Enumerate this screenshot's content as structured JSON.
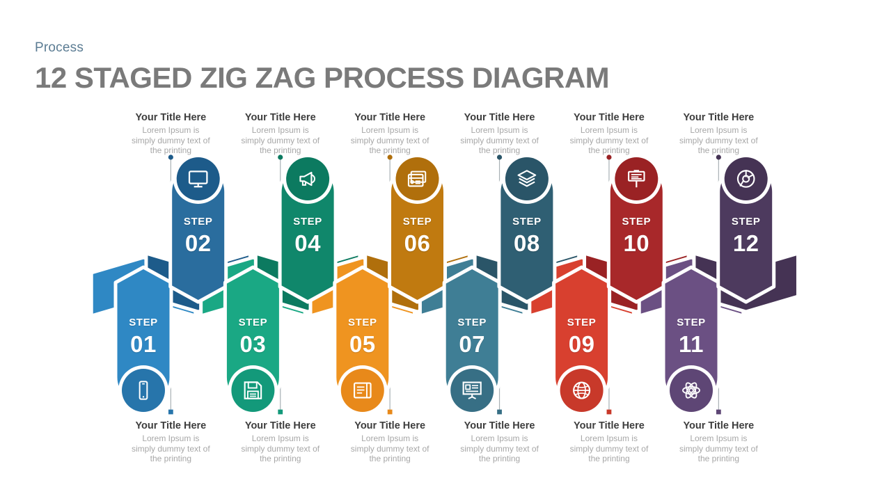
{
  "header": {
    "kicker": "Process",
    "title": "12 STAGED ZIG ZAG PROCESS DIAGRAM"
  },
  "defaults": {
    "label_title": "Your Title Here",
    "label_desc_line1": "Lorem Ipsum is",
    "label_desc_line2": "simply dummy text of",
    "label_desc_line3": "the printing",
    "step_word": "STEP"
  },
  "palette": {
    "title_gray": "#7a7a7a",
    "kicker_blue": "#5b7c93",
    "desc_gray": "#a7a7a7",
    "label_dark": "#3d3d3d",
    "connector_gray": "#9aa3a8",
    "white": "#ffffff"
  },
  "steps": [
    {
      "number": "01",
      "step_word": "STEP",
      "row": "bottom",
      "icon": "mobile-icon",
      "color_light": "#2f88c4",
      "color_dark": "#2775ab",
      "title": "Your Title Here",
      "desc": [
        "Lorem Ipsum is",
        "simply dummy text of",
        "the printing"
      ]
    },
    {
      "number": "02",
      "step_word": "STEP",
      "row": "top",
      "icon": "monitor-icon",
      "color_light": "#2a6d9e",
      "color_dark": "#1d5b8a",
      "title": "Your Title Here",
      "desc": [
        "Lorem Ipsum is",
        "simply dummy text of",
        "the printing"
      ]
    },
    {
      "number": "03",
      "step_word": "STEP",
      "row": "bottom",
      "icon": "floppy-disk-icon",
      "color_light": "#1aa884",
      "color_dark": "#13997a",
      "title": "Your Title Here",
      "desc": [
        "Lorem Ipsum is",
        "simply dummy text of",
        "the printing"
      ]
    },
    {
      "number": "04",
      "step_word": "STEP",
      "row": "top",
      "icon": "megaphone-icon",
      "color_light": "#10876b",
      "color_dark": "#0c7a60",
      "title": "Your Title Here",
      "desc": [
        "Lorem Ipsum is",
        "simply dummy text of",
        "the printing"
      ]
    },
    {
      "number": "05",
      "step_word": "STEP",
      "row": "bottom",
      "icon": "notebook-icon",
      "color_light": "#ef9420",
      "color_dark": "#e8891a",
      "title": "Your Title Here",
      "desc": [
        "Lorem Ipsum is",
        "simply dummy text of",
        "the printing"
      ]
    },
    {
      "number": "06",
      "step_word": "STEP",
      "row": "top",
      "icon": "window-card-icon",
      "color_light": "#c07a10",
      "color_dark": "#b06f0c",
      "title": "Your Title Here",
      "desc": [
        "Lorem Ipsum is",
        "simply dummy text of",
        "the printing"
      ]
    },
    {
      "number": "07",
      "step_word": "STEP",
      "row": "bottom",
      "icon": "presentation-icon",
      "color_light": "#3f7e95",
      "color_dark": "#376f85",
      "title": "Your Title Here",
      "desc": [
        "Lorem Ipsum is",
        "simply dummy text of",
        "the printing"
      ]
    },
    {
      "number": "08",
      "step_word": "STEP",
      "row": "top",
      "icon": "layers-icon",
      "color_light": "#2f5f73",
      "color_dark": "#2a5568",
      "title": "Your Title Here",
      "desc": [
        "Lorem Ipsum is",
        "simply dummy text of",
        "the printing"
      ]
    },
    {
      "number": "09",
      "step_word": "STEP",
      "row": "bottom",
      "icon": "globe-icon",
      "color_light": "#d8402f",
      "color_dark": "#c8392a",
      "title": "Your Title Here",
      "desc": [
        "Lorem Ipsum is",
        "simply dummy text of",
        "the printing"
      ]
    },
    {
      "number": "10",
      "step_word": "STEP",
      "row": "top",
      "icon": "signboard-icon",
      "color_light": "#a8282a",
      "color_dark": "#9a2224",
      "title": "Your Title Here",
      "desc": [
        "Lorem Ipsum is",
        "simply dummy text of",
        "the printing"
      ]
    },
    {
      "number": "11",
      "step_word": "STEP",
      "row": "bottom",
      "icon": "atom-icon",
      "color_light": "#6b5083",
      "color_dark": "#5e4675",
      "title": "Your Title Here",
      "desc": [
        "Lorem Ipsum is",
        "simply dummy text of",
        "the printing"
      ]
    },
    {
      "number": "12",
      "step_word": "STEP",
      "row": "top",
      "icon": "aperture-icon",
      "color_light": "#4d3a5e",
      "color_dark": "#453354",
      "title": "Your Title Here",
      "desc": [
        "Lorem Ipsum is",
        "simply dummy text of",
        "the printing"
      ]
    }
  ]
}
